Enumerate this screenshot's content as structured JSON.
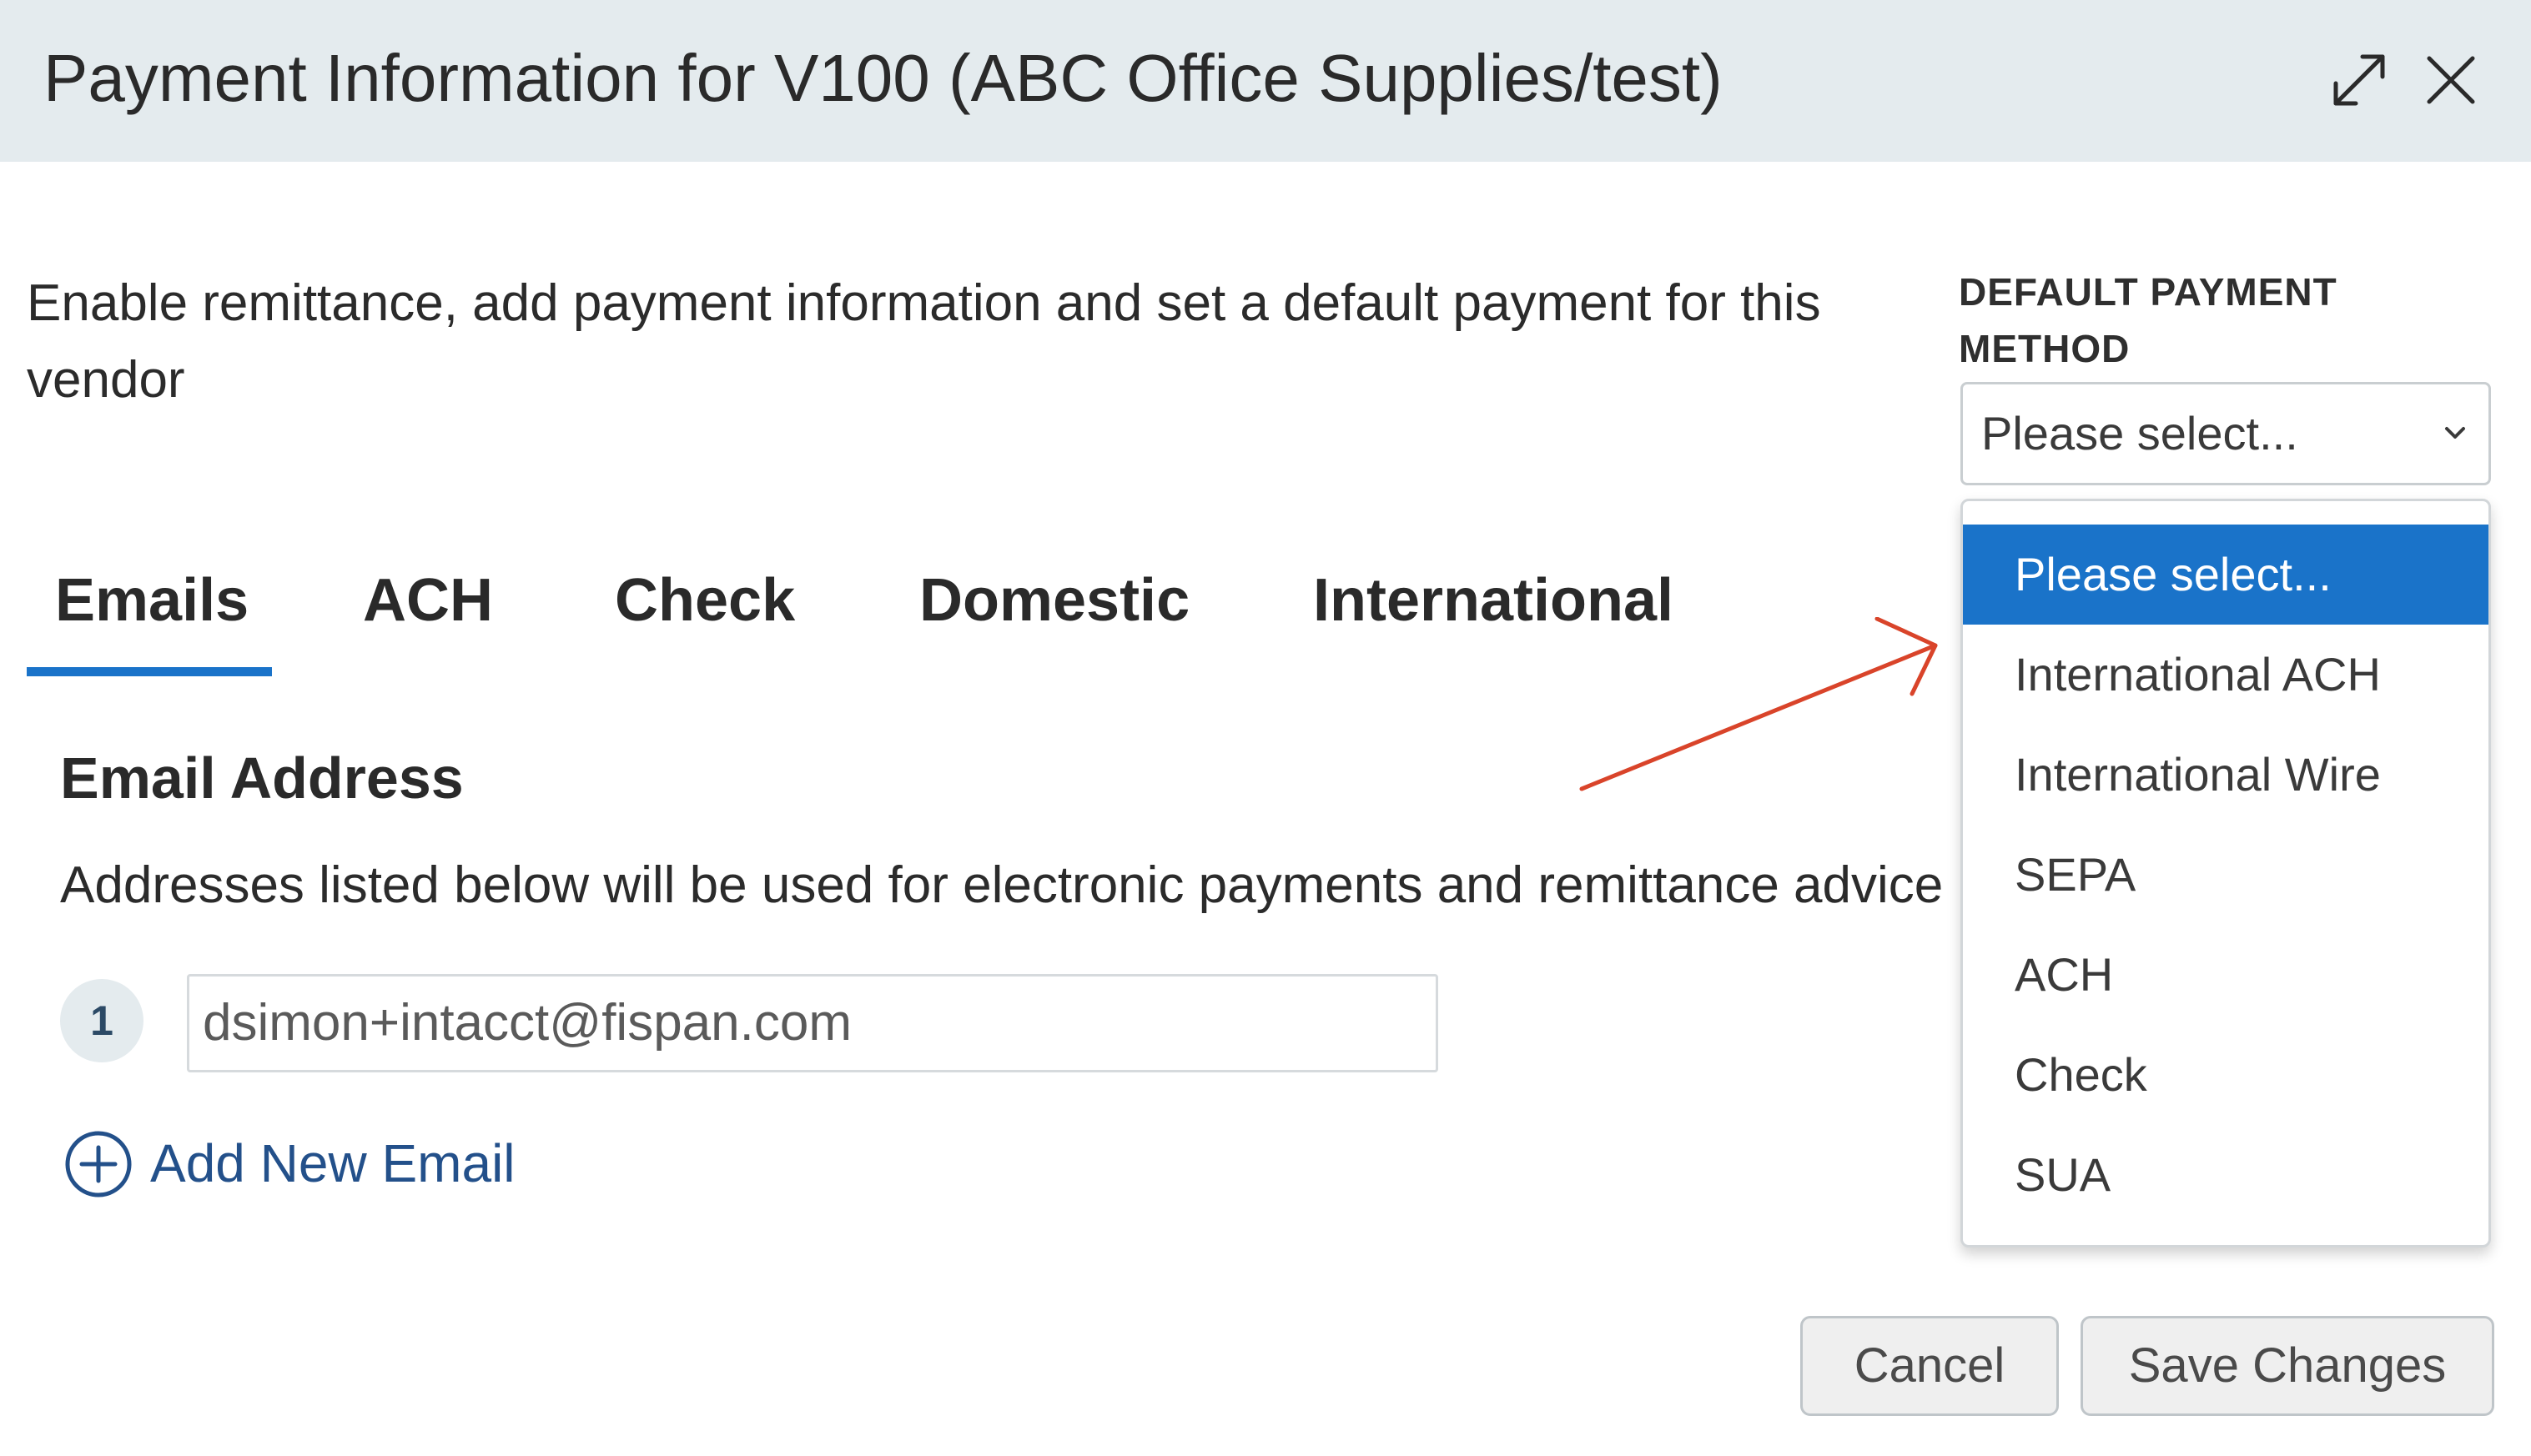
{
  "dialog": {
    "title": "Payment Information for V100 (ABC Office Supplies/test)",
    "icons": {
      "expand": "expand-icon",
      "close": "close-icon"
    }
  },
  "intro_text": "Enable remittance, add payment information and set a default payment for this vendor",
  "default_payment": {
    "label": "DEFAULT PAYMENT METHOD",
    "selected": "Please select...",
    "options": [
      "Please select...",
      "International ACH",
      "International Wire",
      "SEPA",
      "ACH",
      "Check",
      "SUA"
    ]
  },
  "tabs": [
    {
      "label": "Emails",
      "active": true
    },
    {
      "label": "ACH",
      "active": false
    },
    {
      "label": "Check",
      "active": false
    },
    {
      "label": "Domestic",
      "active": false
    },
    {
      "label": "International",
      "active": false
    }
  ],
  "emails_section": {
    "title": "Email Address",
    "description": "Addresses listed below will be used for electronic payments and remittance advice",
    "entries": [
      {
        "index": "1",
        "value": "dsimon+intacct@fispan.com"
      }
    ],
    "add_label": "Add New Email"
  },
  "footer": {
    "cancel_label": "Cancel",
    "save_label": "Save Changes"
  },
  "colors": {
    "accent": "#1a73c9",
    "header_bg": "#e4ebee",
    "link": "#23508a",
    "annotation_arrow": "#d9442a"
  }
}
